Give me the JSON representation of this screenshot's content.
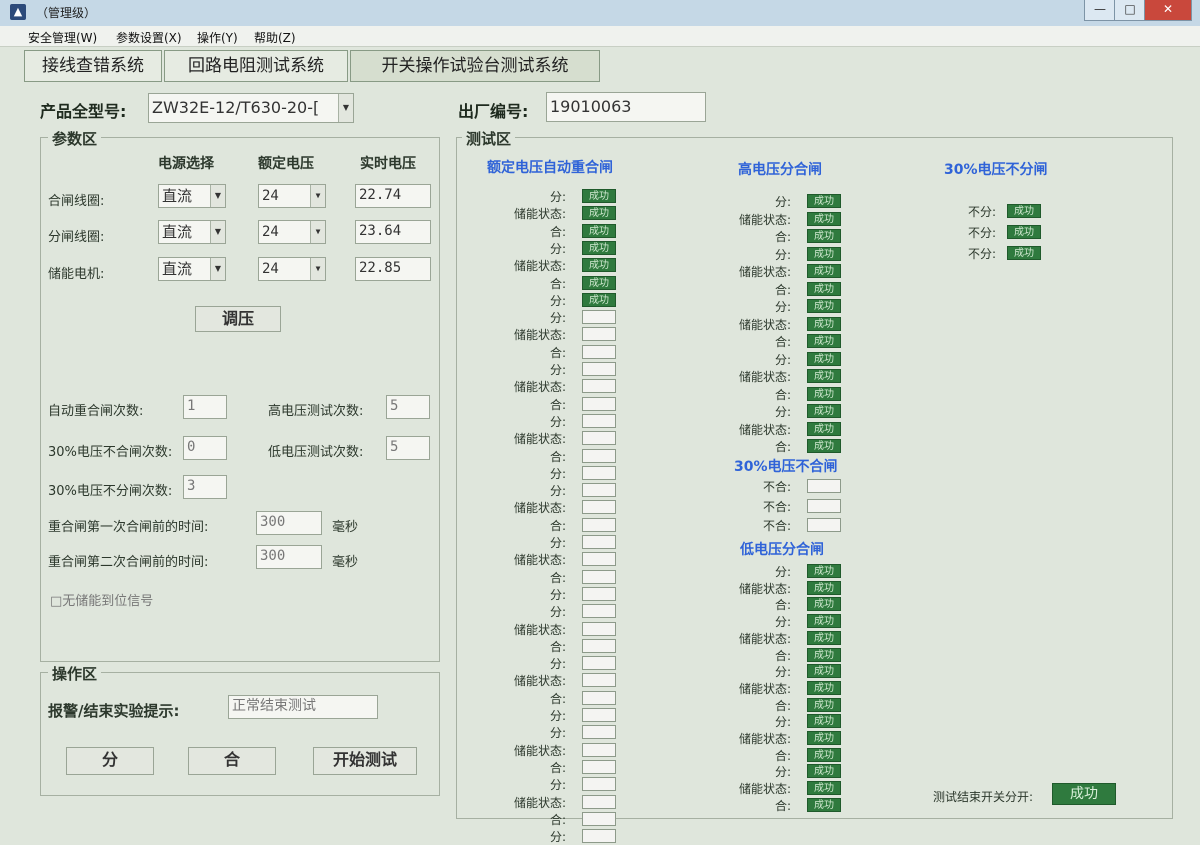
{
  "window": {
    "title": "（管理级）",
    "icon": "app-icon",
    "minimize": "—",
    "maximize": "□",
    "close": "✕"
  },
  "menu": [
    "安全管理(W)",
    "参数设置(X)",
    "操作(Y)",
    "帮助(Z)"
  ],
  "tabs": [
    "接线查错系统",
    "回路电阻测试系统",
    "开关操作试验台测试系统"
  ],
  "product": {
    "label": "产品全型号:",
    "value": "ZW32E-12/T630-20-["
  },
  "serial": {
    "label": "出厂编号:",
    "value": "19010063"
  },
  "params": {
    "title": "参数区",
    "headers": [
      "电源选择",
      "额定电压",
      "实时电压"
    ],
    "rows": [
      {
        "label": "合闸线圈:",
        "source": "直流",
        "rated": "24",
        "realtime": "22.74"
      },
      {
        "label": "分闸线圈:",
        "source": "直流",
        "rated": "24",
        "realtime": "23.64"
      },
      {
        "label": "储能电机:",
        "source": "直流",
        "rated": "24",
        "realtime": "22.85"
      }
    ],
    "adjust_button": "调压",
    "auto_reclose_count": {
      "label": "自动重合闸次数:",
      "value": "1"
    },
    "high_voltage_count": {
      "label": "高电压测试次数:",
      "value": "5"
    },
    "no_close_30_count": {
      "label": "30%电压不合闸次数:",
      "value": "0"
    },
    "low_voltage_count": {
      "label": "低电压测试次数:",
      "value": "5"
    },
    "no_open_30_count": {
      "label": "30%电压不分闸次数:",
      "value": "3"
    },
    "first_reclose_time": {
      "label": "重合闸第一次合闸前的时间:",
      "value": "300",
      "unit": "毫秒"
    },
    "second_reclose_time": {
      "label": "重合闸第二次合闸前的时间:",
      "value": "300",
      "unit": "毫秒"
    },
    "no_storage_checkbox": "□无储能到位信号"
  },
  "operation": {
    "title": "操作区",
    "alarm_label": "报警/结束实验提示:",
    "alarm_value": "正常结束测试",
    "buttons": [
      "分",
      "合",
      "开始测试"
    ]
  },
  "test": {
    "title": "测试区",
    "success_text": "成功",
    "auto_reclose": {
      "title": "额定电压自动重合闸",
      "rows": [
        {
          "l": "分:",
          "ok": true
        },
        {
          "l": "储能状态:",
          "ok": true
        },
        {
          "l": "合:",
          "ok": true
        },
        {
          "l": "分:",
          "ok": true
        },
        {
          "l": "储能状态:",
          "ok": true
        },
        {
          "l": "合:",
          "ok": true
        },
        {
          "l": "分:",
          "ok": true
        },
        {
          "l": "分:",
          "ok": false
        },
        {
          "l": "储能状态:",
          "ok": false
        },
        {
          "l": "合:",
          "ok": false
        },
        {
          "l": "分:",
          "ok": false
        },
        {
          "l": "储能状态:",
          "ok": false
        },
        {
          "l": "合:",
          "ok": false
        },
        {
          "l": "分:",
          "ok": false
        },
        {
          "l": "储能状态:",
          "ok": false
        },
        {
          "l": "合:",
          "ok": false
        },
        {
          "l": "分:",
          "ok": false
        },
        {
          "l": "分:",
          "ok": false
        },
        {
          "l": "储能状态:",
          "ok": false
        },
        {
          "l": "合:",
          "ok": false
        },
        {
          "l": "分:",
          "ok": false
        },
        {
          "l": "储能状态:",
          "ok": false
        },
        {
          "l": "合:",
          "ok": false
        },
        {
          "l": "分:",
          "ok": false
        },
        {
          "l": "分:",
          "ok": false
        },
        {
          "l": "储能状态:",
          "ok": false
        },
        {
          "l": "合:",
          "ok": false
        },
        {
          "l": "分:",
          "ok": false
        },
        {
          "l": "储能状态:",
          "ok": false
        },
        {
          "l": "合:",
          "ok": false
        },
        {
          "l": "分:",
          "ok": false
        },
        {
          "l": "分:",
          "ok": false
        },
        {
          "l": "储能状态:",
          "ok": false
        },
        {
          "l": "合:",
          "ok": false
        },
        {
          "l": "分:",
          "ok": false
        },
        {
          "l": "储能状态:",
          "ok": false
        },
        {
          "l": "合:",
          "ok": false
        },
        {
          "l": "分:",
          "ok": false
        }
      ]
    },
    "high_voltage": {
      "title": "高电压分合闸",
      "rows": [
        {
          "l": "分:",
          "ok": true
        },
        {
          "l": "储能状态:",
          "ok": true
        },
        {
          "l": "合:",
          "ok": true
        },
        {
          "l": "分:",
          "ok": true
        },
        {
          "l": "储能状态:",
          "ok": true
        },
        {
          "l": "合:",
          "ok": true
        },
        {
          "l": "分:",
          "ok": true
        },
        {
          "l": "储能状态:",
          "ok": true
        },
        {
          "l": "合:",
          "ok": true
        },
        {
          "l": "分:",
          "ok": true
        },
        {
          "l": "储能状态:",
          "ok": true
        },
        {
          "l": "合:",
          "ok": true
        },
        {
          "l": "分:",
          "ok": true
        },
        {
          "l": "储能状态:",
          "ok": true
        },
        {
          "l": "合:",
          "ok": true
        }
      ]
    },
    "no_close_30": {
      "title": "30%电压不合闸",
      "rows": [
        {
          "l": "不合:",
          "ok": false
        },
        {
          "l": "不合:",
          "ok": false
        },
        {
          "l": "不合:",
          "ok": false
        }
      ]
    },
    "low_voltage": {
      "title": "低电压分合闸",
      "rows": [
        {
          "l": "分:",
          "ok": true
        },
        {
          "l": "储能状态:",
          "ok": true
        },
        {
          "l": "合:",
          "ok": true
        },
        {
          "l": "分:",
          "ok": true
        },
        {
          "l": "储能状态:",
          "ok": true
        },
        {
          "l": "合:",
          "ok": true
        },
        {
          "l": "分:",
          "ok": true
        },
        {
          "l": "储能状态:",
          "ok": true
        },
        {
          "l": "合:",
          "ok": true
        },
        {
          "l": "分:",
          "ok": true
        },
        {
          "l": "储能状态:",
          "ok": true
        },
        {
          "l": "合:",
          "ok": true
        },
        {
          "l": "分:",
          "ok": true
        },
        {
          "l": "储能状态:",
          "ok": true
        },
        {
          "l": "合:",
          "ok": true
        }
      ]
    },
    "no_open_30": {
      "title": "30%电压不分闸",
      "rows": [
        {
          "l": "不分:",
          "ok": true
        },
        {
          "l": "不分:",
          "ok": true
        },
        {
          "l": "不分:",
          "ok": true
        }
      ]
    },
    "footer_label": "测试结束开关分开:",
    "footer_value": "成功"
  },
  "colors": {
    "success": "#2f7a3e",
    "section_title": "#2f63d8",
    "background": "#dfe6dc"
  }
}
